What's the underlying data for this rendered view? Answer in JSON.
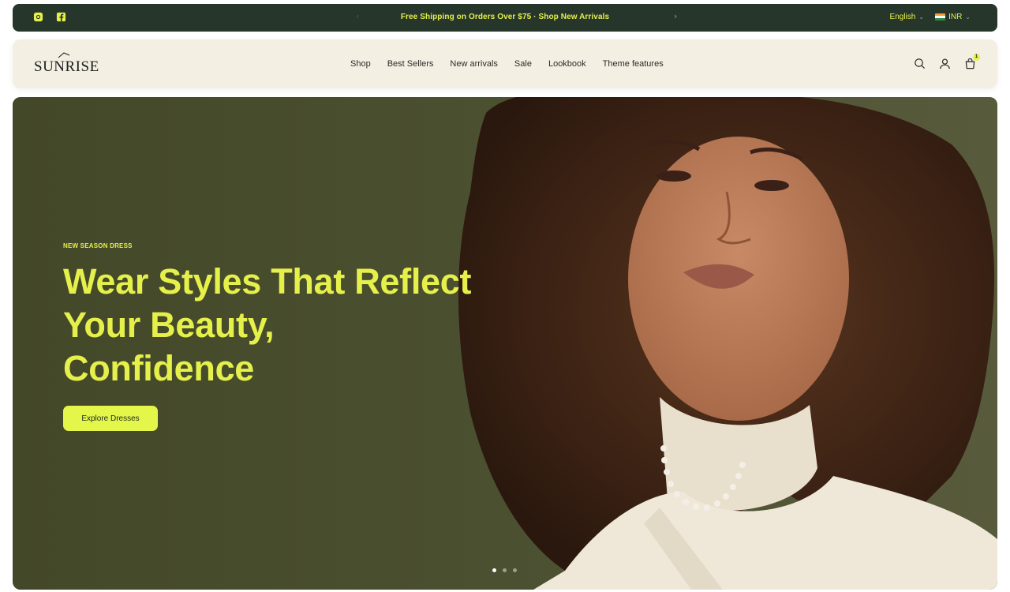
{
  "announcement": {
    "message": "Free Shipping on Orders Over $75 · Shop New Arrivals",
    "prev_arrow": "‹",
    "next_arrow": "›",
    "social_icons": [
      "instagram-icon",
      "facebook-icon"
    ],
    "language": "English",
    "currency": "INR",
    "chevron": "⌄"
  },
  "header": {
    "logo": "SUNRISE",
    "nav": [
      "Shop",
      "Best Sellers",
      "New arrivals",
      "Sale",
      "Lookbook",
      "Theme features"
    ],
    "icons": [
      "search-icon",
      "account-icon",
      "cart-icon"
    ],
    "cart_count": "1"
  },
  "hero": {
    "eyebrow": "NEW SEASON DRESS",
    "headline": "Wear Styles That Reflect Your Beauty, Confidence",
    "cta_label": "Explore Dresses",
    "slide_count": 3,
    "active_slide": 1
  },
  "colors": {
    "announcement_bg": "#26362b",
    "accent": "#e6f04a",
    "header_bg": "#f3efe3",
    "hero_bg": "#4a4f31"
  }
}
